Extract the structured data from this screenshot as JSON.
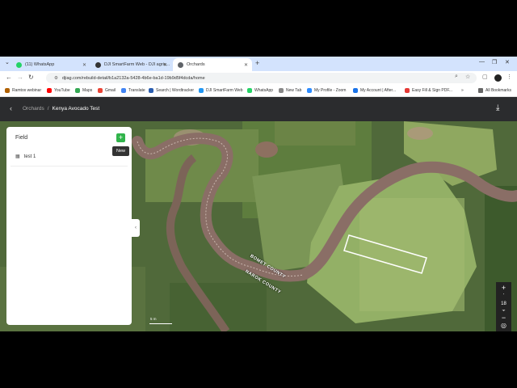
{
  "browser": {
    "tabs": [
      {
        "label": "(11) WhatsApp",
        "color": "#25d366"
      },
      {
        "label": "DJI SmartFarm Web - DJI agric...",
        "color": "#333333"
      },
      {
        "label": "Orchards",
        "color": "#5f6368"
      }
    ],
    "url": "djiag.com/rebuild-detail/b1a2132a-5428-4b6e-ba1d-19b9d5f4dcda/home",
    "bookmarks": [
      {
        "label": "Ramtox webinar",
        "color": "#b06000"
      },
      {
        "label": "YouTube",
        "color": "#ff0000"
      },
      {
        "label": "Maps",
        "color": "#34a853"
      },
      {
        "label": "Gmail",
        "color": "#ea4335"
      },
      {
        "label": "Translate",
        "color": "#4285f4"
      },
      {
        "label": "Search | Wordtracker",
        "color": "#2a5db0"
      },
      {
        "label": "DJI SmartFarm Web",
        "color": "#2196f3"
      },
      {
        "label": "WhatsApp",
        "color": "#25d366"
      },
      {
        "label": "New Tab",
        "color": "#888888"
      },
      {
        "label": "My Profile - Zoom",
        "color": "#2d8cff"
      },
      {
        "label": "My Account | After...",
        "color": "#1a73e8"
      },
      {
        "label": "Easy Fill & Sign PDF...",
        "color": "#e53935"
      }
    ],
    "all_bookmarks_label": "All Bookmarks"
  },
  "app": {
    "breadcrumb_parent": "Orchards",
    "breadcrumb_separator": "/",
    "breadcrumb_current": "Kenya Avocado Test"
  },
  "panel": {
    "title": "Field",
    "add_tooltip": "New",
    "fields": [
      {
        "name": "test 1"
      }
    ]
  },
  "map": {
    "labels": [
      "BOMET COUNTY",
      "NAROK COUNTY"
    ],
    "scale_label": "5 m",
    "zoom_level": "18"
  }
}
